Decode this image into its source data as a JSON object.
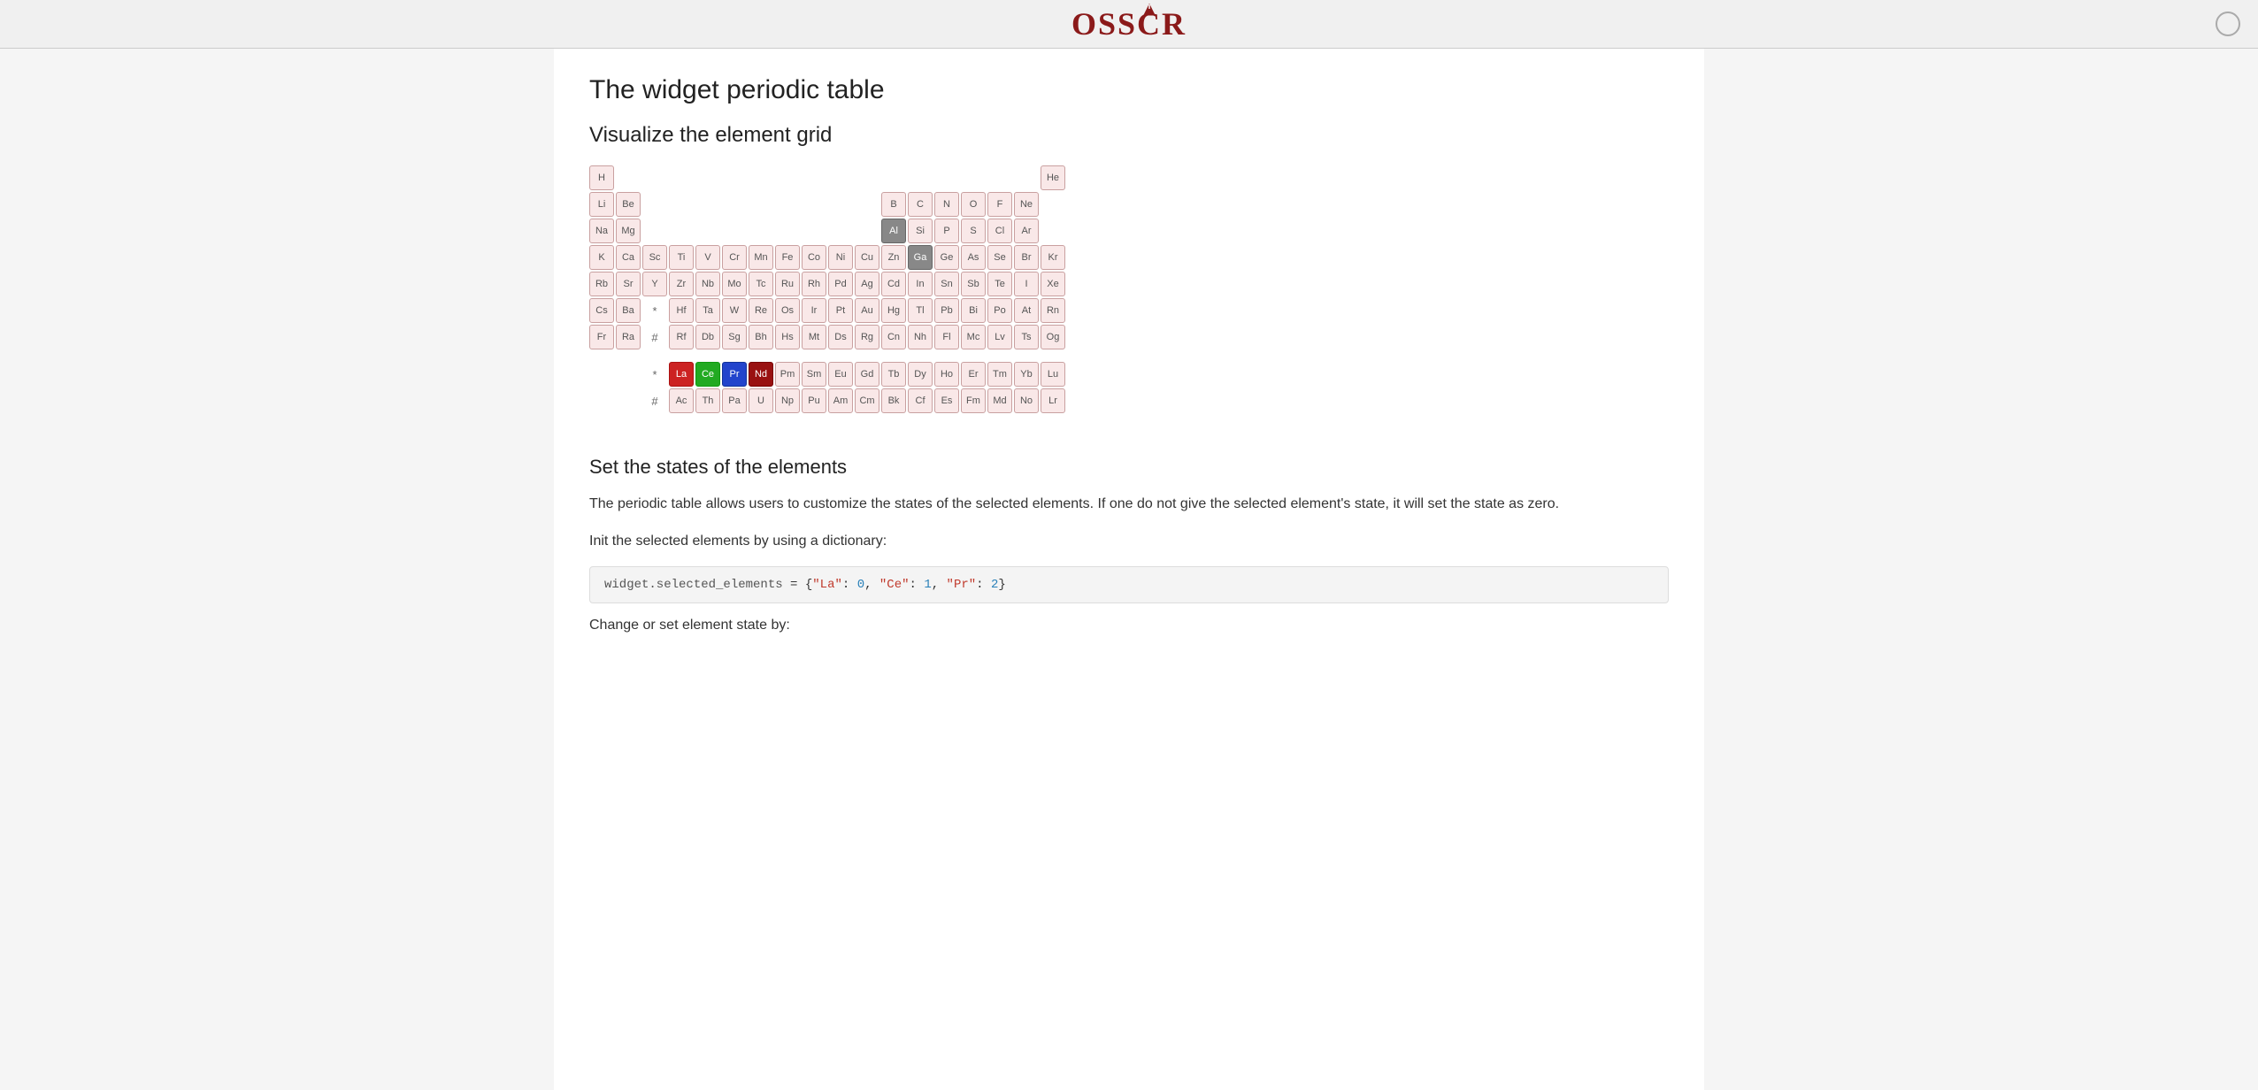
{
  "header": {
    "logo_text": "OSSCAR",
    "circle_label": "circle-indicator"
  },
  "page": {
    "title": "The widget periodic table",
    "section1": {
      "heading": "Visualize the element grid"
    },
    "section2": {
      "heading": "Set the states of the elements",
      "description": "The periodic table allows users to customize the states of the selected elements. If one do not give the selected element's state, it will set the state as zero.",
      "init_label": "Init the selected elements by using a dictionary:",
      "code_line": "widget.selected_elements = {\"La\": 0, \"Ce\": 1, \"Pr\": 2}",
      "change_label": "Change or set element state by:"
    }
  },
  "periodic_table": {
    "row1": [
      "H",
      "",
      "",
      "",
      "",
      "",
      "",
      "",
      "",
      "",
      "",
      "",
      "",
      "",
      "",
      "",
      "",
      "He"
    ],
    "row2": [
      "Li",
      "Be",
      "",
      "",
      "",
      "",
      "",
      "",
      "",
      "",
      "",
      "",
      "",
      "B",
      "C",
      "N",
      "O",
      "F",
      "Ne"
    ],
    "row3": [
      "Na",
      "Mg",
      "",
      "",
      "",
      "",
      "",
      "",
      "",
      "",
      "",
      "",
      "",
      "Al",
      "Si",
      "P",
      "S",
      "Cl",
      "Ar"
    ],
    "row4": [
      "K",
      "Ca",
      "Sc",
      "Ti",
      "V",
      "Cr",
      "Mn",
      "Fe",
      "Co",
      "Ni",
      "Cu",
      "Zn",
      "Ga",
      "Ge",
      "As",
      "Se",
      "Br",
      "Kr"
    ],
    "row5": [
      "Rb",
      "Sr",
      "Y",
      "Zr",
      "Nb",
      "Mo",
      "Tc",
      "Ru",
      "Rh",
      "Pd",
      "Ag",
      "Cd",
      "In",
      "Sn",
      "Sb",
      "Te",
      "I",
      "Xe"
    ],
    "row6": [
      "Cs",
      "Ba",
      "*",
      "Hf",
      "Ta",
      "W",
      "Re",
      "Os",
      "Ir",
      "Pt",
      "Au",
      "Hg",
      "Tl",
      "Pb",
      "Bi",
      "Po",
      "At",
      "Rn"
    ],
    "row7": [
      "Fr",
      "Ra",
      "#",
      "Rf",
      "Db",
      "Sg",
      "Bh",
      "Hs",
      "Mt",
      "Ds",
      "Rg",
      "Cn",
      "Nh",
      "Fl",
      "Mc",
      "Lv",
      "Ts",
      "Og"
    ],
    "lanthanides": [
      "La",
      "Ce",
      "Pr",
      "Nd",
      "Pm",
      "Sm",
      "Eu",
      "Gd",
      "Tb",
      "Dy",
      "Ho",
      "Er",
      "Tm",
      "Yb",
      "Lu"
    ],
    "actinides": [
      "Ac",
      "Th",
      "Pa",
      "U",
      "Np",
      "Pu",
      "Am",
      "Cm",
      "Bk",
      "Cf",
      "Es",
      "Fm",
      "Md",
      "No",
      "Lr"
    ],
    "special_colors": {
      "Ga": "dark-bg",
      "Al": "dark-bg",
      "La": "red-bg",
      "Ce": "green-bg",
      "Pr": "blue-bg",
      "Nd": "darkred-bg"
    }
  }
}
